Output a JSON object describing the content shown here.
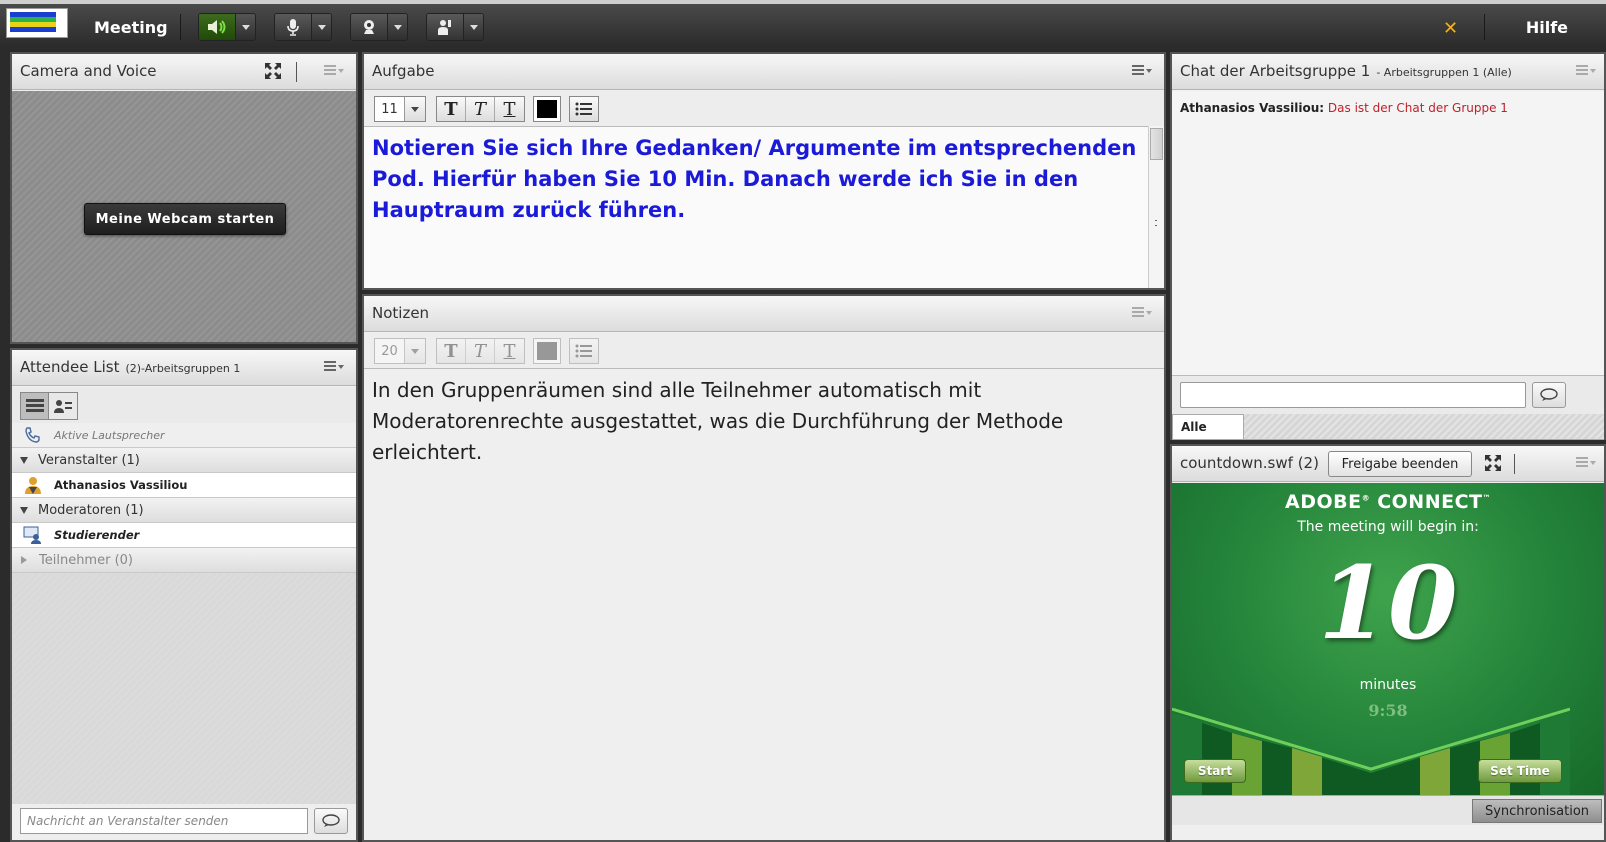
{
  "topbar": {
    "title": "Meeting",
    "help": "Hilfe",
    "icons": [
      "speaker-icon",
      "microphone-icon",
      "webcam-icon",
      "raise-hand-icon",
      "fullscreen-exit-icon"
    ],
    "colors": {
      "speaker_active": "#56c02a",
      "exit": "#f0b020"
    }
  },
  "camera": {
    "title": "Camera and Voice",
    "start_webcam": "Meine Webcam starten"
  },
  "attendees": {
    "title": "Attendee List",
    "subtitle": "(2)-Arbeitsgruppen 1",
    "active_speakers": "Aktive Lautsprecher",
    "groups": {
      "hosts": "Veranstalter (1)",
      "host_person": "Athanasios Vassiliou",
      "presenters": "Moderatoren (1)",
      "presenter_person": "Studierender",
      "participants": "Teilnehmer (0)"
    },
    "message_placeholder": "Nachricht an Veranstalter senden"
  },
  "aufgabe": {
    "title": "Aufgabe",
    "font_size": "11",
    "text": "Notieren Sie sich Ihre Gedanken/ Argumente im entsprechenden Pod. Hierfür haben Sie 10 Min. Danach werde ich Sie in den Hauptraum zurück führen.",
    "text_color": "#1a1ad8"
  },
  "notizen": {
    "title": "Notizen",
    "font_size": "20",
    "text": "In den Gruppenräumen sind alle Teilnehmer automatisch mit Moderatorenrechte ausgestattet, was die Durchführung der Methode erleichtert."
  },
  "chat": {
    "title": "Chat der Arbeitsgruppe 1",
    "subtitle": "- Arbeitsgruppen 1 (Alle)",
    "messages": [
      {
        "sender": "Athanasios Vassiliou:",
        "text": "Das ist der Chat der Gruppe 1"
      }
    ],
    "tab": "Alle"
  },
  "countdown": {
    "title": "countdown.swf (2)",
    "stop_share": "Freigabe beenden",
    "brand": "ADOBE",
    "brand2": "CONNECT",
    "tm": "™",
    "reg": "®",
    "subtitle": "The meeting will begin in:",
    "number": "10",
    "unit": "minutes",
    "time": "9:58",
    "start": "Start",
    "set_time": "Set Time",
    "sync": "Synchronisation"
  }
}
